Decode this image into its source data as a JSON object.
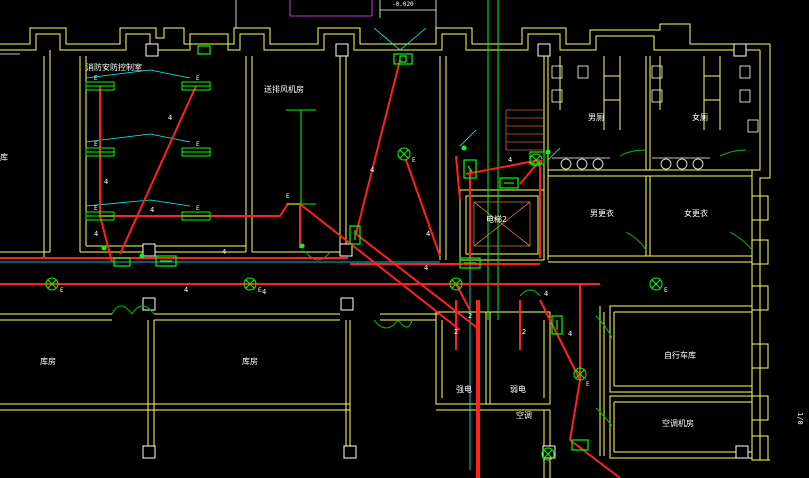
{
  "drawing": {
    "elevation_label": "-0.020",
    "right_edge_label": "1/0"
  },
  "rooms": [
    {
      "id": "fire-control",
      "label": "消防安防控制室"
    },
    {
      "id": "supply-fan",
      "label": "送排风机房"
    },
    {
      "id": "elevator",
      "label": "电梯2"
    },
    {
      "id": "male-washroom",
      "label": "男厕"
    },
    {
      "id": "female-washroom",
      "label": "女厕"
    },
    {
      "id": "male-locker",
      "label": "男更衣"
    },
    {
      "id": "female-locker",
      "label": "女更衣"
    },
    {
      "id": "storage-left",
      "label": "库房"
    },
    {
      "id": "storage-mid",
      "label": "库房"
    },
    {
      "id": "shaft-a",
      "label": "强电"
    },
    {
      "id": "shaft-b",
      "label": "弱电"
    },
    {
      "id": "ac-lower",
      "label": "空调"
    },
    {
      "id": "dry-room",
      "label": "自行车库"
    },
    {
      "id": "ac-room",
      "label": "空调机房"
    },
    {
      "id": "edge-room",
      "label": "库"
    }
  ],
  "wire_labels": [
    "4",
    "4",
    "4",
    "4",
    "4",
    "4",
    "4",
    "4",
    "4",
    "4",
    "4",
    "4",
    "4",
    "2",
    "2",
    "2"
  ],
  "fixture_letter": "E",
  "colors": {
    "background": "#000000",
    "wall": "#ffff66",
    "wire": "#ff2020",
    "fixture": "#00ff00",
    "accent": "#00ffff",
    "door": "#00c000",
    "text": "#ffffff",
    "frame": "#ffffff"
  },
  "icons": {
    "fluorescent": "fluorescent-lamp-icon",
    "ceiling": "ceiling-lamp-icon",
    "exit": "exit-sign-icon",
    "switch": "switch-icon"
  }
}
